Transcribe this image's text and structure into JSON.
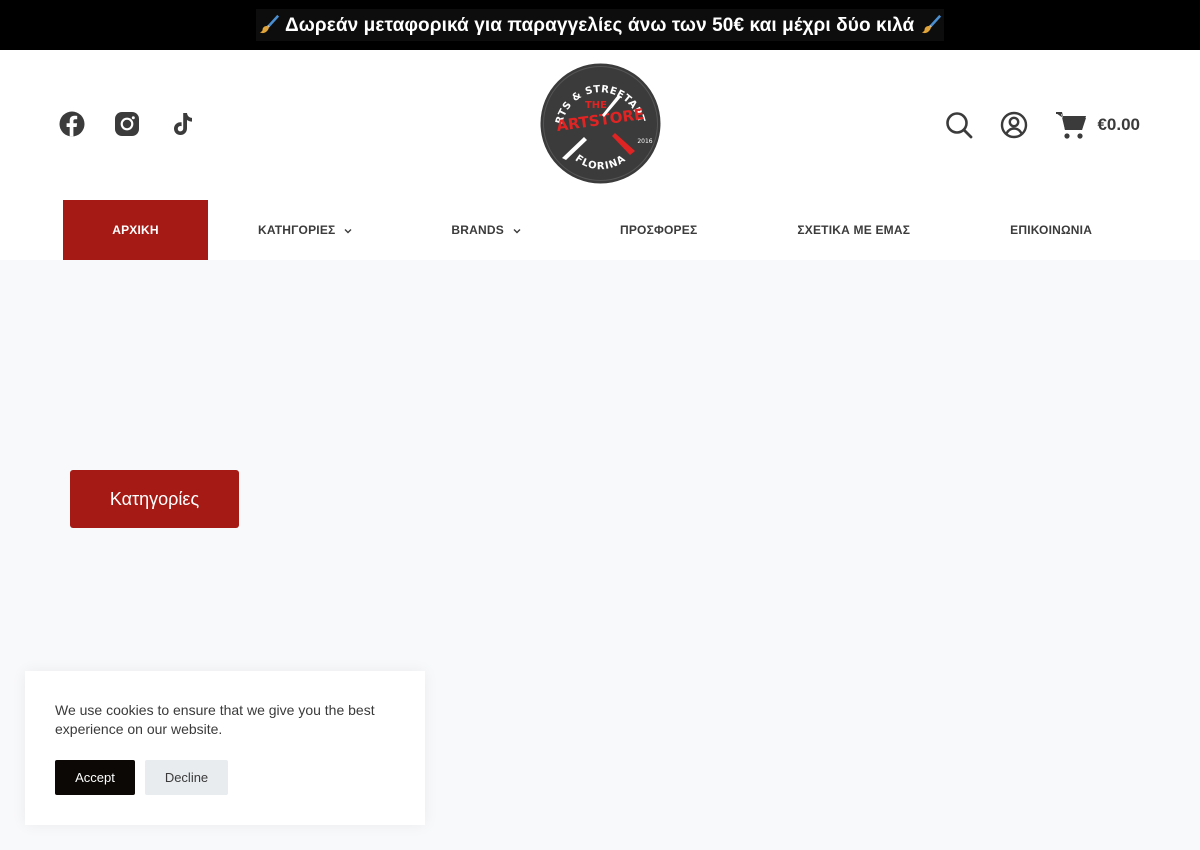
{
  "announcement": {
    "text": "Δωρεάν μεταφορικά για παραγγελίες άνω των 50€ και μέχρι δύο κιλά",
    "icon": "paintbrush-icon"
  },
  "social": [
    {
      "name": "facebook",
      "icon": "facebook-icon"
    },
    {
      "name": "instagram",
      "icon": "instagram-icon"
    },
    {
      "name": "tiktok",
      "icon": "tiktok-icon"
    }
  ],
  "logo": {
    "top_text": "FINEARTS & STREETART SHOP",
    "the": "THE",
    "name": "ARTSTORE",
    "bottom_text": "FLORINA",
    "year": "2016"
  },
  "header_actions": {
    "search_icon": "search-icon",
    "account_icon": "user-circle-icon",
    "cart_icon": "cart-icon",
    "cart_total": "€0.00"
  },
  "nav": {
    "items": [
      {
        "label": "ΑΡΧΙΚΗ",
        "active": true,
        "has_dropdown": false
      },
      {
        "label": "ΚΑΤΗΓΟΡΙΕΣ",
        "active": false,
        "has_dropdown": true
      },
      {
        "label": "BRANDS",
        "active": false,
        "has_dropdown": true
      },
      {
        "label": "ΠΡΟΣΦΟΡΕΣ",
        "active": false,
        "has_dropdown": false
      },
      {
        "label": "ΣΧΕΤΙΚΑ ΜΕ ΕΜΑΣ",
        "active": false,
        "has_dropdown": false
      },
      {
        "label": "ΕΠΙΚΟΙΝΩΝΙΑ",
        "active": false,
        "has_dropdown": false
      }
    ]
  },
  "main": {
    "categories_button": "Κατηγορίες"
  },
  "cookie_banner": {
    "text": "We use cookies to ensure that we give you the best experience on our website.",
    "accept_label": "Accept",
    "decline_label": "Decline"
  },
  "colors": {
    "brand_red": "#a51a14",
    "topbar_bg": "#000000",
    "page_bg": "#f8f9fb"
  }
}
